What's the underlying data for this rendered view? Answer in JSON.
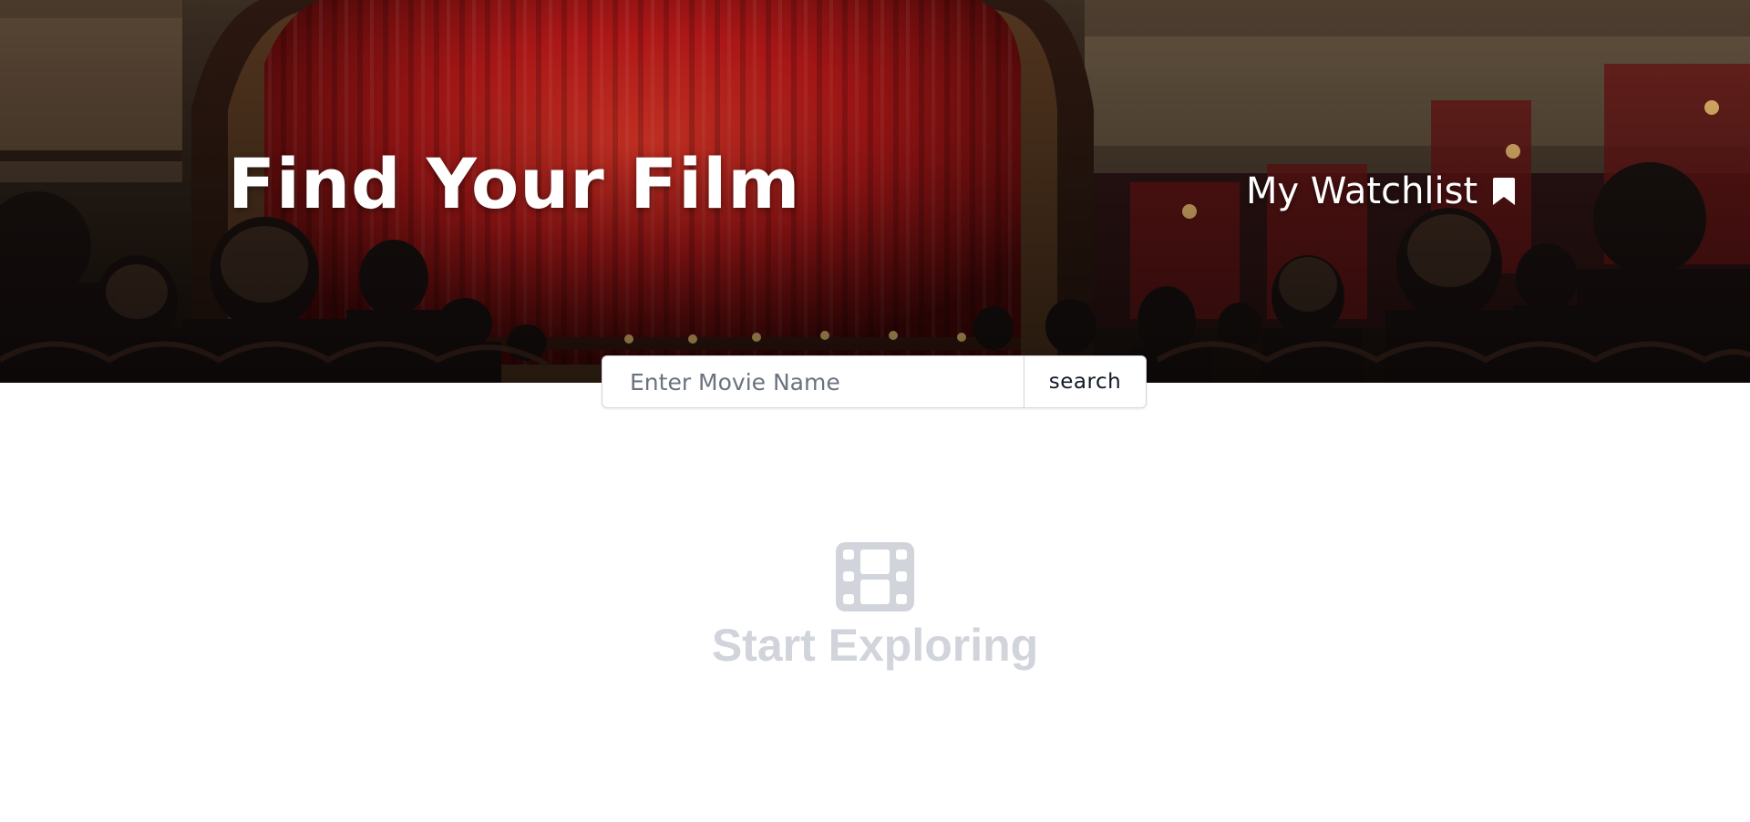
{
  "header": {
    "brand_title": "Find Your Film",
    "watchlist_label": "My Watchlist",
    "watchlist_icon": "bookmark-icon"
  },
  "search": {
    "placeholder": "Enter Movie Name",
    "value": "",
    "button_label": "search"
  },
  "empty_state": {
    "icon": "film-icon",
    "title": "Start Exploring"
  },
  "colors": {
    "hero_curtain": "#c81e1e",
    "text_on_hero": "#ffffff",
    "empty_state": "#d1d5db",
    "search_border": "#d1d5db"
  }
}
